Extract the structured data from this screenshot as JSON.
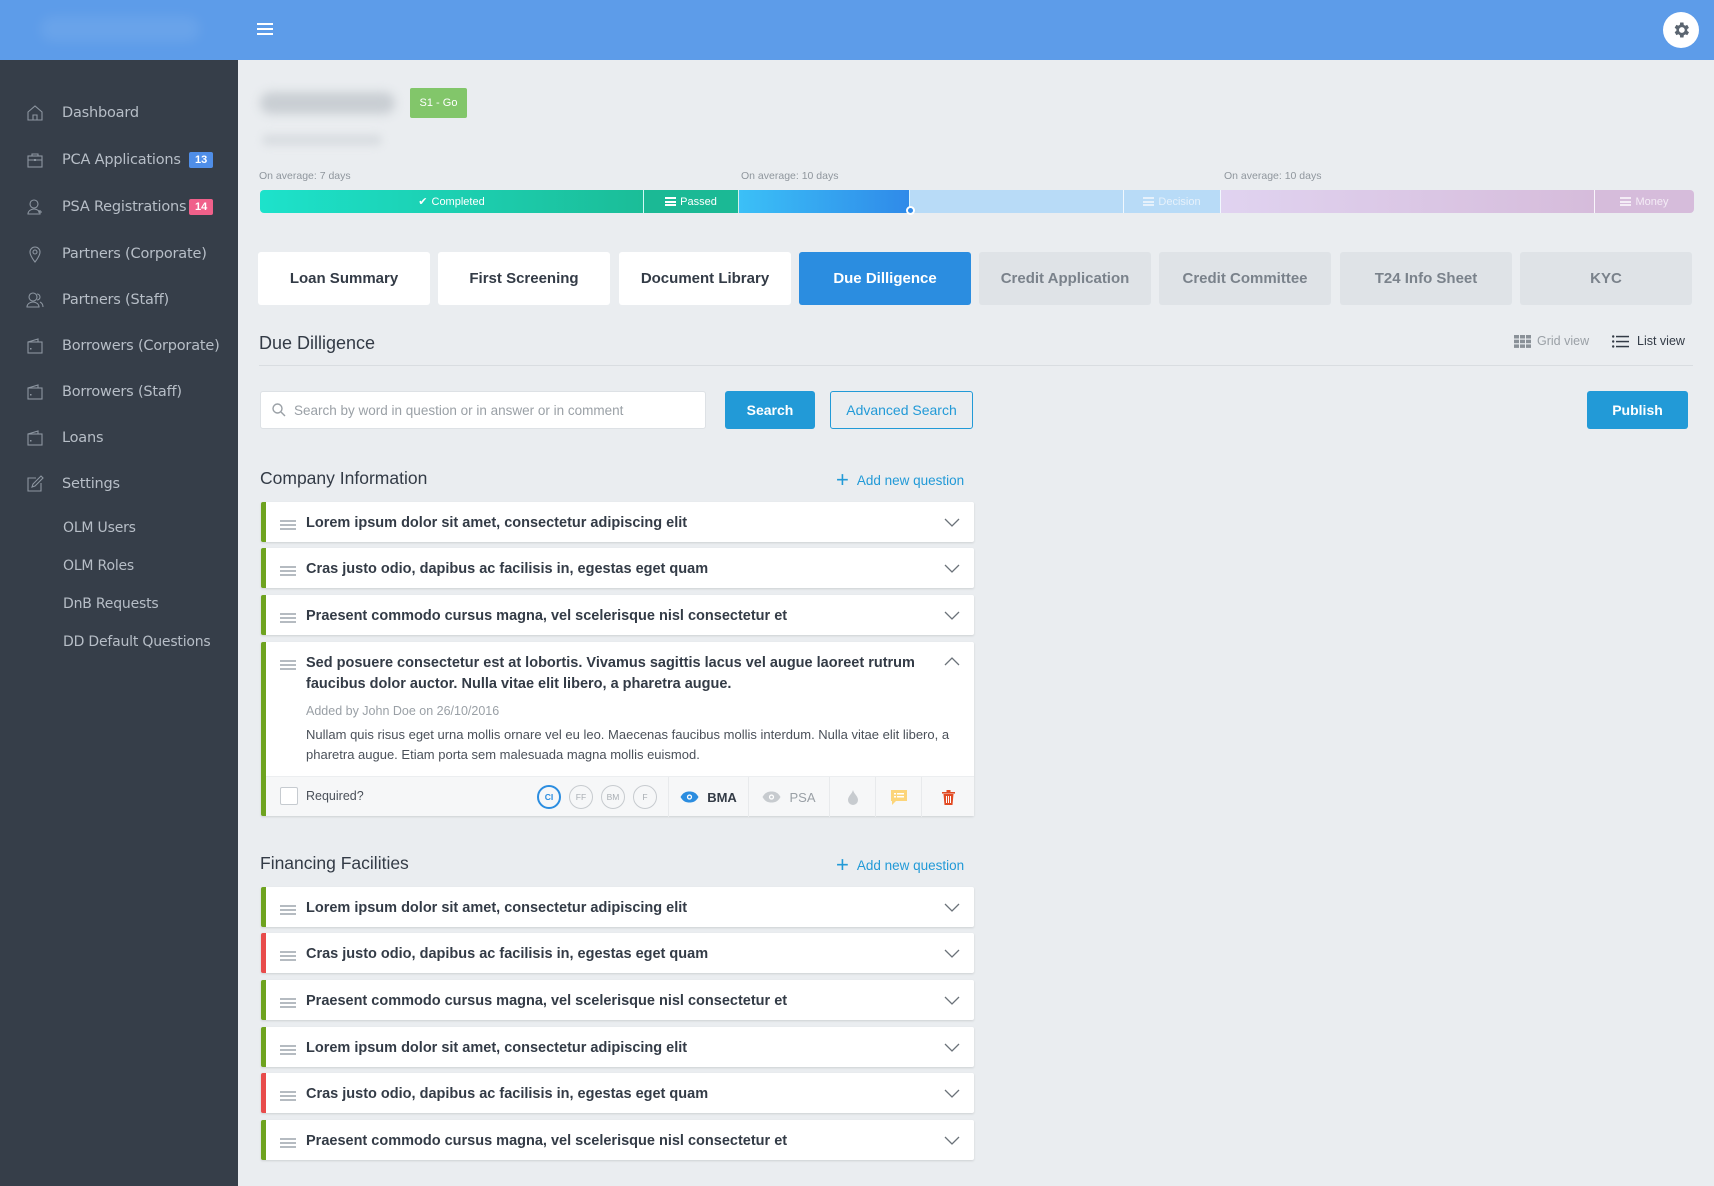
{
  "topbar": {
    "menu_icon": "hamburger-icon",
    "settings_icon": "gear-icon"
  },
  "sidebar": {
    "items": [
      {
        "label": "Dashboard",
        "icon": "home-icon"
      },
      {
        "label": "PCA Applications",
        "icon": "briefcase-icon",
        "badge": "13",
        "badge_color": "#4f8ee8"
      },
      {
        "label": "PSA Registrations",
        "icon": "user-add-icon",
        "badge": "14",
        "badge_color": "#f0608a"
      },
      {
        "label": "Partners (Corporate)",
        "icon": "location-pin-icon"
      },
      {
        "label": "Partners (Staff)",
        "icon": "users-icon"
      },
      {
        "label": "Borrowers (Corporate)",
        "icon": "wallet-icon"
      },
      {
        "label": "Borrowers (Staff)",
        "icon": "wallet-icon"
      },
      {
        "label": "Loans",
        "icon": "wallet-icon"
      },
      {
        "label": "Settings",
        "icon": "edit-icon"
      }
    ],
    "sub_items": [
      {
        "label": "OLM Users"
      },
      {
        "label": "OLM Roles"
      },
      {
        "label": "DnB Requests"
      },
      {
        "label": "DD Default Questions"
      }
    ]
  },
  "header": {
    "stage_badge": "S1 - Go",
    "stage_badge_color": "#82c66a"
  },
  "progress": {
    "averages": [
      "On average: 7 days",
      "On average: 10 days",
      "On average: 10 days"
    ],
    "segments": [
      {
        "label": "Completed",
        "icon": "check-icon",
        "state": "done"
      },
      {
        "label": "Passed",
        "icon": "stack-icon",
        "state": "done"
      },
      {
        "label": "",
        "state": "current"
      },
      {
        "label": "",
        "state": "pending"
      },
      {
        "label": "Decision",
        "icon": "stack-icon",
        "state": "pending"
      },
      {
        "label": "",
        "state": "future"
      },
      {
        "label": "Money",
        "icon": "stack-icon",
        "state": "future"
      }
    ]
  },
  "tabs": [
    {
      "label": "Loan Summary",
      "state": "done"
    },
    {
      "label": "First Screening",
      "state": "done"
    },
    {
      "label": "Document Library",
      "state": "done"
    },
    {
      "label": "Due Dilligence",
      "state": "active"
    },
    {
      "label": "Credit Application",
      "state": "locked"
    },
    {
      "label": "Credit Committee",
      "state": "locked"
    },
    {
      "label": "T24 Info Sheet",
      "state": "locked"
    },
    {
      "label": "KYC",
      "state": "locked"
    }
  ],
  "section": {
    "title": "Due Dilligence",
    "grid_view": "Grid view",
    "list_view": "List view",
    "search_placeholder": "Search by word in question or in answer or in comment",
    "search_value": "",
    "search_button": "Search",
    "advanced_search_button": "Advanced Search",
    "publish_button": "Publish"
  },
  "groups": [
    {
      "title": "Company Information",
      "add_label": "Add new question",
      "questions": [
        {
          "text": "Lorem ipsum dolor sit amet, consectetur adipiscing elit",
          "status": "green"
        },
        {
          "text": "Cras justo odio, dapibus ac facilisis in, egestas eget quam",
          "status": "green"
        },
        {
          "text": "Praesent commodo cursus magna, vel scelerisque nisl consectetur et",
          "status": "green"
        },
        {
          "text": "Sed posuere consectetur est at lobortis. Vivamus sagittis lacus vel augue laoreet rutrum faucibus dolor auctor. Nulla vitae elit libero, a pharetra augue.",
          "status": "green",
          "expanded": true,
          "meta": "Added by John Doe on 26/10/2016",
          "answer": "Nullam quis risus eget urna mollis ornare vel eu leo. Maecenas faucibus mollis interdum. Nulla vitae elit libero, a pharetra augue. Etiam porta sem malesuada magna mollis euismod.",
          "required_label": "Required?",
          "required": false,
          "tags": [
            {
              "label": "CI",
              "active": true
            },
            {
              "label": "FF",
              "active": false
            },
            {
              "label": "BM",
              "active": false
            },
            {
              "label": "F",
              "active": false
            }
          ],
          "visibility": [
            {
              "label": "BMA",
              "active": true
            },
            {
              "label": "PSA",
              "active": false
            }
          ]
        }
      ]
    },
    {
      "title": "Financing Facilities",
      "add_label": "Add new question",
      "questions": [
        {
          "text": "Lorem ipsum dolor sit amet, consectetur adipiscing elit",
          "status": "green"
        },
        {
          "text": "Cras justo odio, dapibus ac facilisis in, egestas eget quam",
          "status": "red"
        },
        {
          "text": "Praesent commodo cursus magna, vel scelerisque nisl consectetur et",
          "status": "green"
        },
        {
          "text": "Lorem ipsum dolor sit amet, consectetur adipiscing elit",
          "status": "green"
        },
        {
          "text": "Cras justo odio, dapibus ac facilisis in, egestas eget quam",
          "status": "red"
        },
        {
          "text": "Praesent commodo cursus magna, vel scelerisque nisl consectetur et",
          "status": "green"
        }
      ]
    }
  ]
}
